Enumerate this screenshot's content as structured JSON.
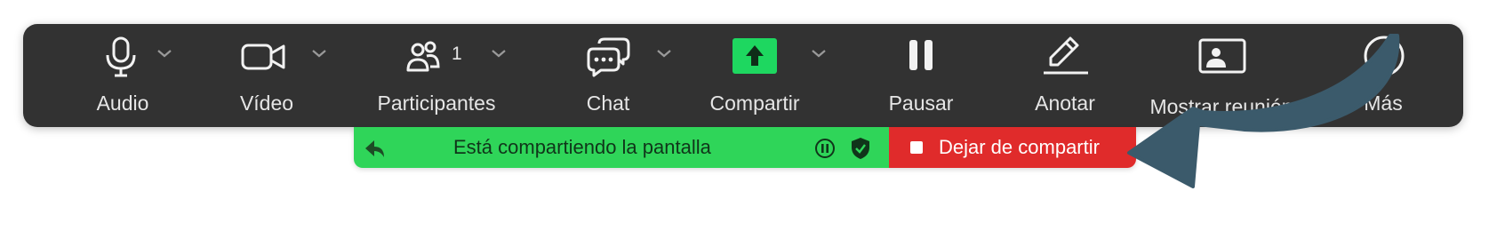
{
  "toolbar": {
    "audio_label": "Audio",
    "video_label": "Vídeo",
    "participants_label": "Participantes",
    "participants_count": "1",
    "chat_label": "Chat",
    "share_label": "Compartir",
    "pause_label": "Pausar",
    "annotate_label": "Anotar",
    "show_meeting_label": "Mostrar reunión",
    "more_label": "Más"
  },
  "share_bar": {
    "status_text": "Está compartiendo la pantalla",
    "stop_label": "Dejar de compartir"
  },
  "colors": {
    "toolbar_bg": "#323232",
    "share_green": "#2fd559",
    "share_accent": "#1ed760",
    "stop_red": "#e02b2b",
    "annotation_arrow": "#3b5a6b"
  }
}
